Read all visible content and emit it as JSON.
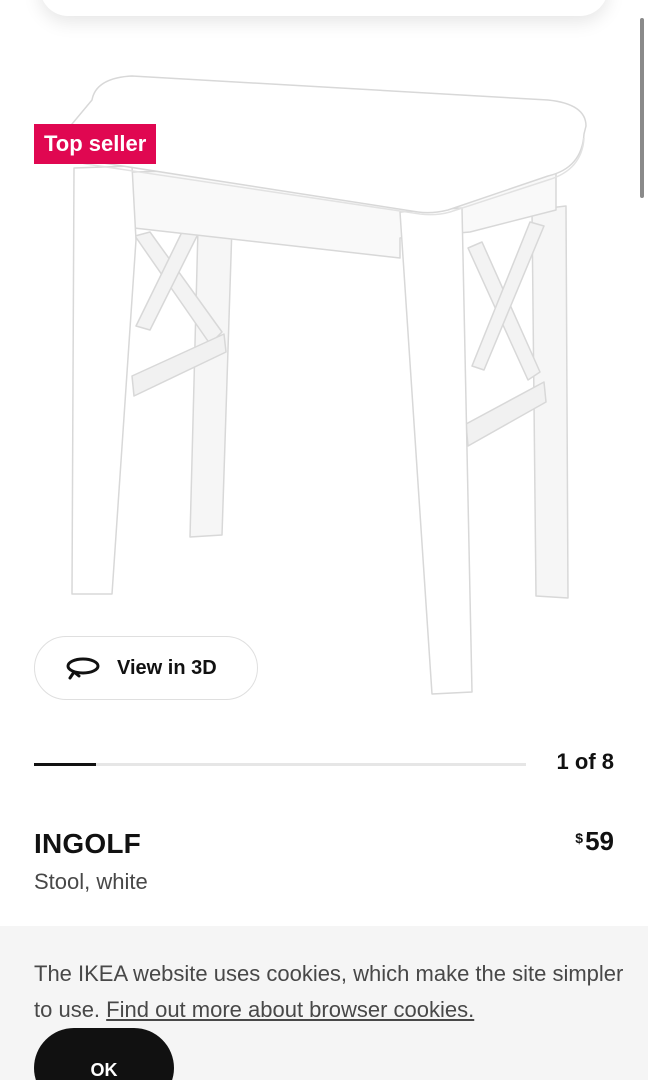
{
  "product": {
    "badge": "Top seller",
    "view_3d_label": "View in 3D",
    "image_counter": "1 of 8",
    "image_progress": 0.125,
    "name": "INGOLF",
    "description": "Stool, white",
    "price_currency": "$",
    "price_value": "59"
  },
  "cookie_banner": {
    "text": "The IKEA website uses cookies, which make the site simpler to use.",
    "link_text": "Find out more about browser cookies.",
    "ok_label": "OK"
  },
  "icons": {
    "view_3d": "rotate-3d-icon"
  },
  "colors": {
    "badge_bg": "#e00751",
    "ok_button_bg": "#111111",
    "cookie_bg": "#f5f5f5"
  }
}
